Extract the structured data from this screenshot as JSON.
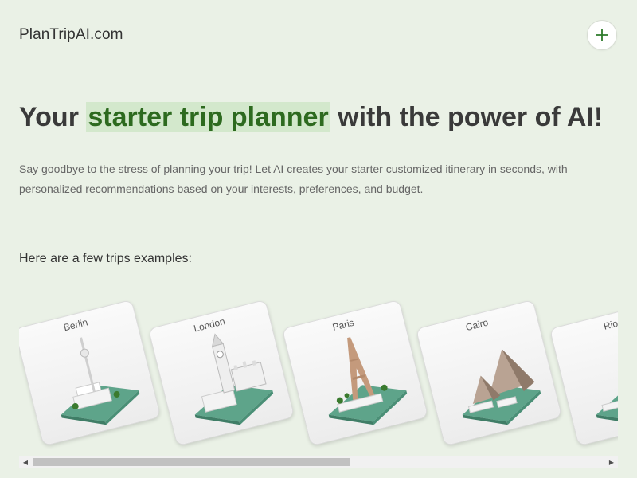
{
  "header": {
    "brand": "PlanTripAI.com",
    "add_button_icon": "plus-icon"
  },
  "hero": {
    "title_before": "Your ",
    "title_highlight": "starter trip planner",
    "title_after": " with the power of AI!",
    "description": "Say goodbye to the stress of planning your trip! Let AI creates your starter customized itinerary in seconds, with personalized recommendations based on your interests, preferences, and budget."
  },
  "examples": {
    "label": "Here are a few trips examples:",
    "cards": [
      {
        "name": "Berlin",
        "icon": "tv-tower-icon"
      },
      {
        "name": "London",
        "icon": "big-ben-icon"
      },
      {
        "name": "Paris",
        "icon": "eiffel-tower-icon"
      },
      {
        "name": "Cairo",
        "icon": "pyramids-icon"
      },
      {
        "name": "Rio",
        "icon": "rio-icon"
      }
    ]
  },
  "colors": {
    "background": "#eaf1e6",
    "accent": "#2d6a1f",
    "highlight": "#d3e8cc",
    "base_green": "#5ea48a"
  }
}
